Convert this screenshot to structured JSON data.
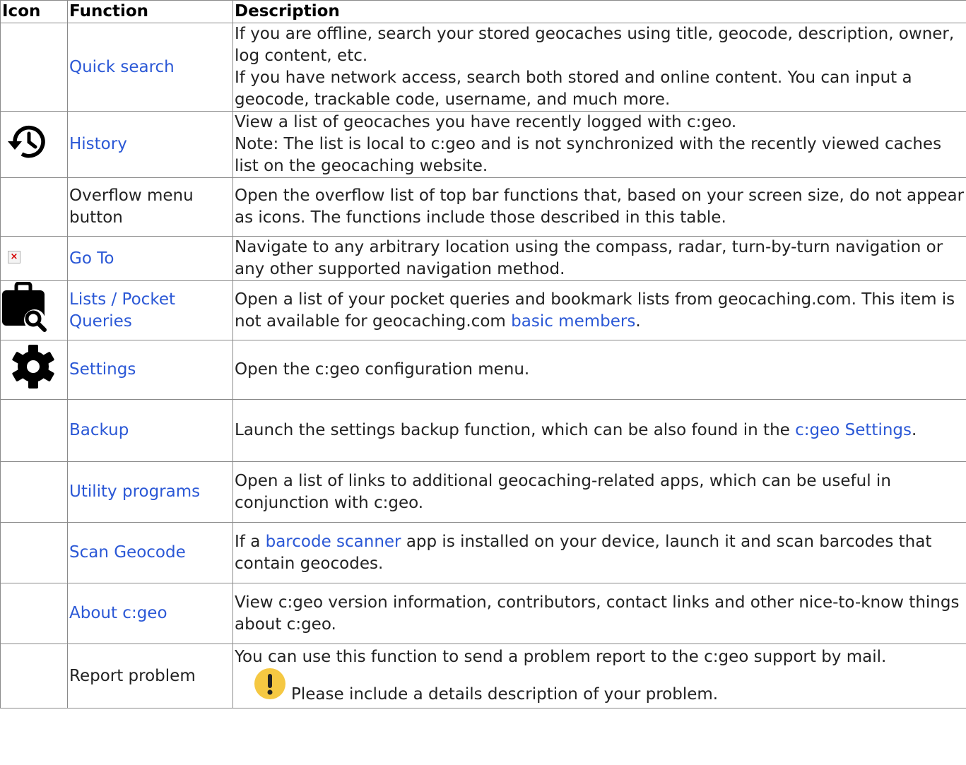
{
  "header": {
    "icon": "Icon",
    "function": "Function",
    "description": "Description"
  },
  "rows": [
    {
      "function": "Quick search",
      "desc": [
        "If you are offline, search your stored geocaches using title, geocode, description, owner, log content, etc.",
        "If you have network access, search both stored and online content. You can input a geocode, trackable code, username, and much more."
      ]
    },
    {
      "icon": "history-icon",
      "function": "History",
      "desc": [
        "View a list of geocaches you have recently logged with c:geo.",
        "Note: The list is local to c:geo and is not synchronized with the recently viewed caches list on the geocaching website."
      ]
    },
    {
      "function": "Overflow menu button",
      "desc": [
        "Open the overflow list of top bar functions that, based on your screen size, do not appear as icons. The functions include those described in this table."
      ]
    },
    {
      "icon": "broken-image-icon",
      "function": "Go To",
      "desc": [
        "Navigate to any arbitrary location using the compass, radar, turn-by-turn navigation or any other supported navigation method."
      ]
    },
    {
      "icon": "briefcase-search-icon",
      "function": "Lists / Pocket Queries",
      "desc_before": "Open a list of your pocket queries and bookmark lists from geocaching.com. This item is not available for geocaching.com ",
      "desc_link": "basic members",
      "desc_after": "."
    },
    {
      "icon": "gear-icon",
      "function": "Settings",
      "desc": [
        "Open the c:geo configuration menu."
      ]
    },
    {
      "function": "Backup",
      "desc_before": "Launch the settings backup function, which can be also found in the ",
      "desc_link": "c:geo Settings",
      "desc_after": "."
    },
    {
      "function": "Utility programs",
      "desc": [
        "Open a list of links to additional geocaching-related apps, which can be useful in conjunction with c:geo."
      ]
    },
    {
      "function": "Scan Geocode",
      "desc_before": "If a ",
      "desc_link": "barcode scanner",
      "desc_after": " app is installed on your device, launch it and scan barcodes that contain geocodes."
    },
    {
      "function": "About c:geo",
      "desc": [
        "View c:geo version information, contributors, contact links and other nice-to-know things about c:geo."
      ]
    },
    {
      "function": "Report problem",
      "desc": [
        "You can use this function to send a problem report to the c:geo support by mail."
      ],
      "note_icon": "exclamation-icon",
      "note_color": "#f5c842",
      "note": "Please include a details description of your problem."
    }
  ]
}
